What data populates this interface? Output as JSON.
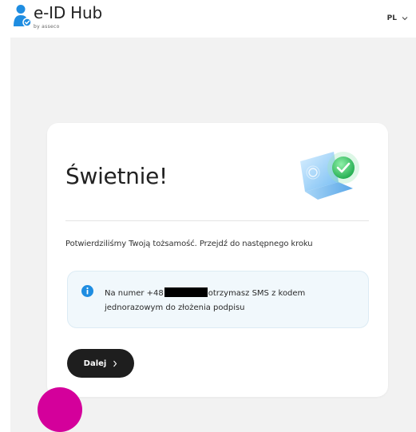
{
  "header": {
    "logo_title": "e-ID Hub",
    "logo_subtitle": "by asseco",
    "language": "PL"
  },
  "card": {
    "title": "Świetnie!",
    "description": "Potwierdziliśmy Twoją tożsamość. Przejdź do następnego kroku",
    "info": {
      "text_before": "Na numer +48",
      "text_after": "otrzymasz SMS z kodem jednorazowym do złożenia podpisu"
    },
    "next_button": "Dalej"
  },
  "colors": {
    "accent_blue": "#1f8de1",
    "success_green": "#2fbf5f",
    "button_dark": "#1e1e1e",
    "pink_dot": "#d4009b",
    "page_background": "#f2f2f2"
  },
  "icons": [
    "user-logo-icon",
    "chevron-down-icon",
    "verified-laptop-illustration",
    "info-icon",
    "chevron-right-icon"
  ]
}
